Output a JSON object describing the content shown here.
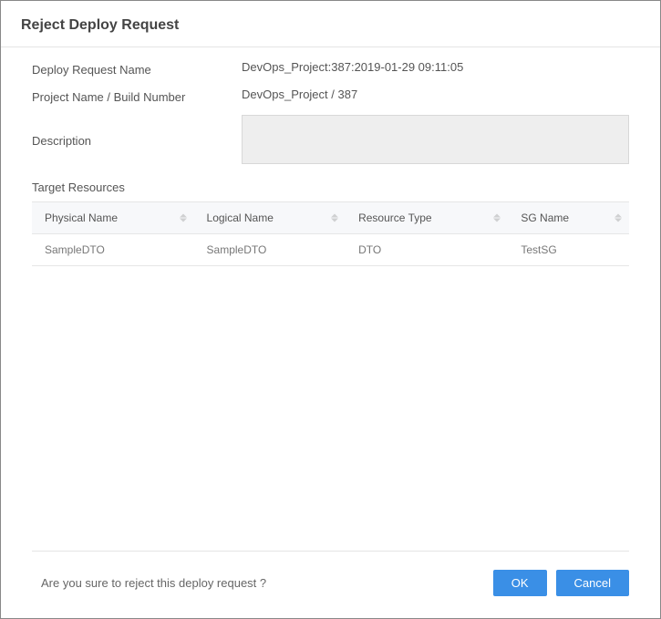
{
  "dialog": {
    "title": "Reject Deploy Request"
  },
  "form": {
    "deployRequestNameLabel": "Deploy Request Name",
    "deployRequestNameValue": "DevOps_Project:387:2019-01-29 09:11:05",
    "projectBuildLabel": "Project Name / Build Number",
    "projectBuildValue": "DevOps_Project / 387",
    "descriptionLabel": "Description",
    "descriptionValue": "",
    "targetResourcesLabel": "Target Resources"
  },
  "table": {
    "headers": {
      "physicalName": "Physical  Name",
      "logicalName": "Logical  Name",
      "resourceType": "Resource  Type",
      "sgName": "SG  Name"
    },
    "rows": [
      {
        "physicalName": "SampleDTO",
        "logicalName": "SampleDTO",
        "resourceType": "DTO",
        "sgName": "TestSG"
      }
    ]
  },
  "footer": {
    "confirmText": "Are you sure to reject this deploy request ?",
    "okLabel": "OK",
    "cancelLabel": "Cancel"
  }
}
